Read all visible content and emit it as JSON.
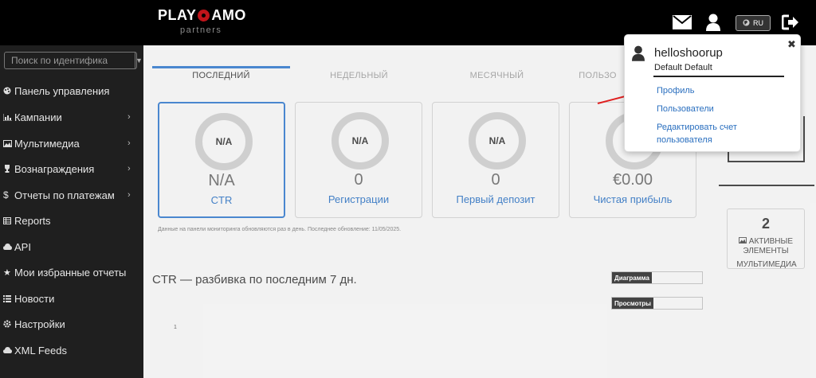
{
  "header": {
    "logo_left": "PLAY",
    "logo_right": "AMO",
    "logo_sub": "partners",
    "lang": "RU"
  },
  "sidebar": {
    "search_placeholder": "Поиск по идентифика",
    "items": [
      {
        "label": "Панель управления",
        "icon": "palette-icon",
        "has_sub": false
      },
      {
        "label": "Кампании",
        "icon": "bar-chart-icon",
        "has_sub": true
      },
      {
        "label": "Мультимедиа",
        "icon": "image-icon",
        "has_sub": true
      },
      {
        "label": "Вознаграждения",
        "icon": "trophy-icon",
        "has_sub": true
      },
      {
        "label": "Отчеты по платежам",
        "icon": "dollar-icon",
        "has_sub": true
      },
      {
        "label": "Reports",
        "icon": "table-icon",
        "has_sub": false
      },
      {
        "label": "API",
        "icon": "cloud-icon",
        "has_sub": false
      },
      {
        "label": "Мои избранные отчеты",
        "icon": "star-icon",
        "has_sub": false
      },
      {
        "label": "Новости",
        "icon": "list-icon",
        "has_sub": false
      },
      {
        "label": "Настройки",
        "icon": "gear-icon",
        "has_sub": false
      },
      {
        "label": "XML Feeds",
        "icon": "cloud-icon",
        "has_sub": false
      }
    ]
  },
  "main": {
    "tabs": [
      {
        "label": "ПОСЛЕДНИЙ",
        "active": true
      },
      {
        "label": "НЕДЕЛЬНЫЙ",
        "active": false
      },
      {
        "label": "МЕСЯЧНЫЙ",
        "active": false
      },
      {
        "label": "ПОЛЬЗО",
        "active": false
      }
    ],
    "cards": [
      {
        "ring": "N/A",
        "value": "N/A",
        "label": "CTR",
        "active": true
      },
      {
        "ring": "N/A",
        "value": "0",
        "label": "Регистрации",
        "active": false
      },
      {
        "ring": "N/A",
        "value": "0",
        "label": "Первый депозит",
        "active": false
      },
      {
        "ring": "",
        "value": "€0.00",
        "label": "Чистая прибыль",
        "active": false
      }
    ],
    "note": "Данные на панели мониторинга обновляются раз в день. Последнее обновление: 11/05/2025.",
    "section_title": "CTR — разбивка по последним 7 дн.",
    "select_chart": "Диаграмма",
    "select_views": "Просмотры",
    "axis_value": "1"
  },
  "right_panel": {
    "stat_number": "2",
    "stat_label_1": "АКТИВНЫЕ",
    "stat_label_2": "ЭЛЕМЕНТЫ",
    "stat_label_3": "МУЛЬТИМЕДИА"
  },
  "popup": {
    "username": "helloshoorup",
    "fullname": "Default Default",
    "links": [
      "Профиль",
      "Пользователи",
      "Редактировать счет пользователя"
    ]
  },
  "colors": {
    "accent": "#3277c9",
    "link": "#2a6fbf",
    "sidebar_bg": "#1f1f1f",
    "topbar_bg": "#000000",
    "arrow": "#e02020"
  }
}
